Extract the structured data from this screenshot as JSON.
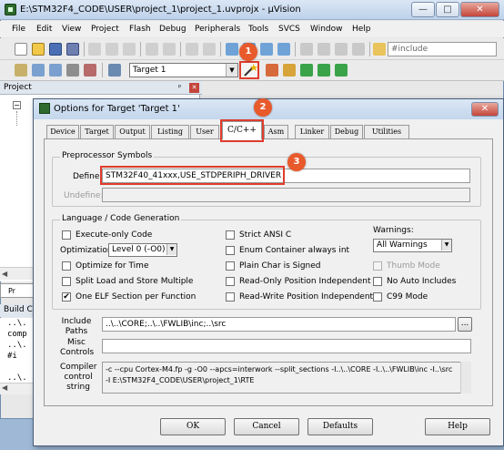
{
  "window": {
    "title": "E:\\STM32F4_CODE\\USER\\project_1\\project_1.uvprojx - µVision",
    "min_glyph": "—",
    "max_glyph": "□",
    "close_glyph": "✕"
  },
  "menu": [
    "File",
    "Edit",
    "View",
    "Project",
    "Flash",
    "Debug",
    "Peripherals",
    "Tools",
    "SVCS",
    "Window",
    "Help"
  ],
  "toolbar": {
    "include_text": "#include",
    "target_name": "Target 1",
    "target_arrow": "▼"
  },
  "project_panel": {
    "title": "Project",
    "tab_label": "Pr",
    "scroll_left": "◀",
    "pin_glyph": "ᵖ",
    "close_glyph": "✕",
    "expander": "−"
  },
  "build_output": {
    "title": "Build C",
    "lines": [
      "..\\.",
      "comp",
      "..\\.",
      "#i",
      "..\\.",
      "..\\."
    ],
    "scroll_left": "◀"
  },
  "dialog": {
    "title": "Options for Target 'Target 1'",
    "close_glyph": "✕",
    "tabs": [
      "Device",
      "Target",
      "Output",
      "Listing",
      "User",
      "C/C++",
      "Asm",
      "Linker",
      "Debug",
      "Utilities"
    ],
    "preprocessor": {
      "group_label": "Preprocessor Symbols",
      "define_label": "Define:",
      "define_value": "STM32F40_41xxx,USE_STDPERIPH_DRIVER",
      "undefine_label": "Undefine:",
      "undefine_value": ""
    },
    "language": {
      "group_label": "Language / Code Generation",
      "execute_only": {
        "label": "Execute-only Code",
        "checked": false
      },
      "optimization_label": "Optimization:",
      "optimization_value": "Level 0 (-O0)",
      "optimize_time": {
        "label": "Optimize for Time",
        "checked": false
      },
      "split_load": {
        "label": "Split Load and Store Multiple",
        "checked": false
      },
      "one_elf": {
        "label": "One ELF Section per Function",
        "checked": true,
        "mark": "✔"
      },
      "strict_ansi": {
        "label": "Strict ANSI C",
        "checked": false
      },
      "enum_container": {
        "label": "Enum Container always int",
        "checked": false
      },
      "plain_char": {
        "label": "Plain Char is Signed",
        "checked": false
      },
      "ro_position": {
        "label": "Read-Only Position Independent",
        "checked": false
      },
      "rw_position": {
        "label": "Read-Write Position Independent",
        "checked": false
      },
      "warnings_label": "Warnings:",
      "warnings_value": "All Warnings",
      "thumb_mode": {
        "label": "Thumb Mode",
        "checked": false,
        "disabled": true
      },
      "no_auto_includes": {
        "label": "No Auto Includes",
        "checked": false
      },
      "c99_mode": {
        "label": "C99 Mode",
        "checked": false
      },
      "select_arrow": "▼"
    },
    "include_paths": {
      "label": "Include\nPaths",
      "value": "..\\..\\CORE;..\\..\\FWLIB\\inc;..\\src",
      "browse_label": "..."
    },
    "misc_controls": {
      "label": "Misc\nControls",
      "value": ""
    },
    "compiler_control": {
      "label": "Compiler\ncontrol\nstring",
      "line1": "-c --cpu Cortex-M4.fp -g -O0 --apcs=interwork --split_sections -I..\\..\\CORE -I..\\..\\FWLIB\\inc -I..\\src",
      "line2": "-I E:\\STM32F4_CODE\\USER\\project_1\\RTE"
    },
    "buttons": {
      "ok": "OK",
      "cancel": "Cancel",
      "defaults": "Defaults",
      "help": "Help"
    }
  },
  "annotations": {
    "badge1": "1",
    "badge2": "2",
    "badge3": "3",
    "color": "#e8592c"
  },
  "colors": {
    "highlight_red": "#e03c2c",
    "title_gradient": "#c3d6ec",
    "selection_blue": "#3574c9"
  }
}
